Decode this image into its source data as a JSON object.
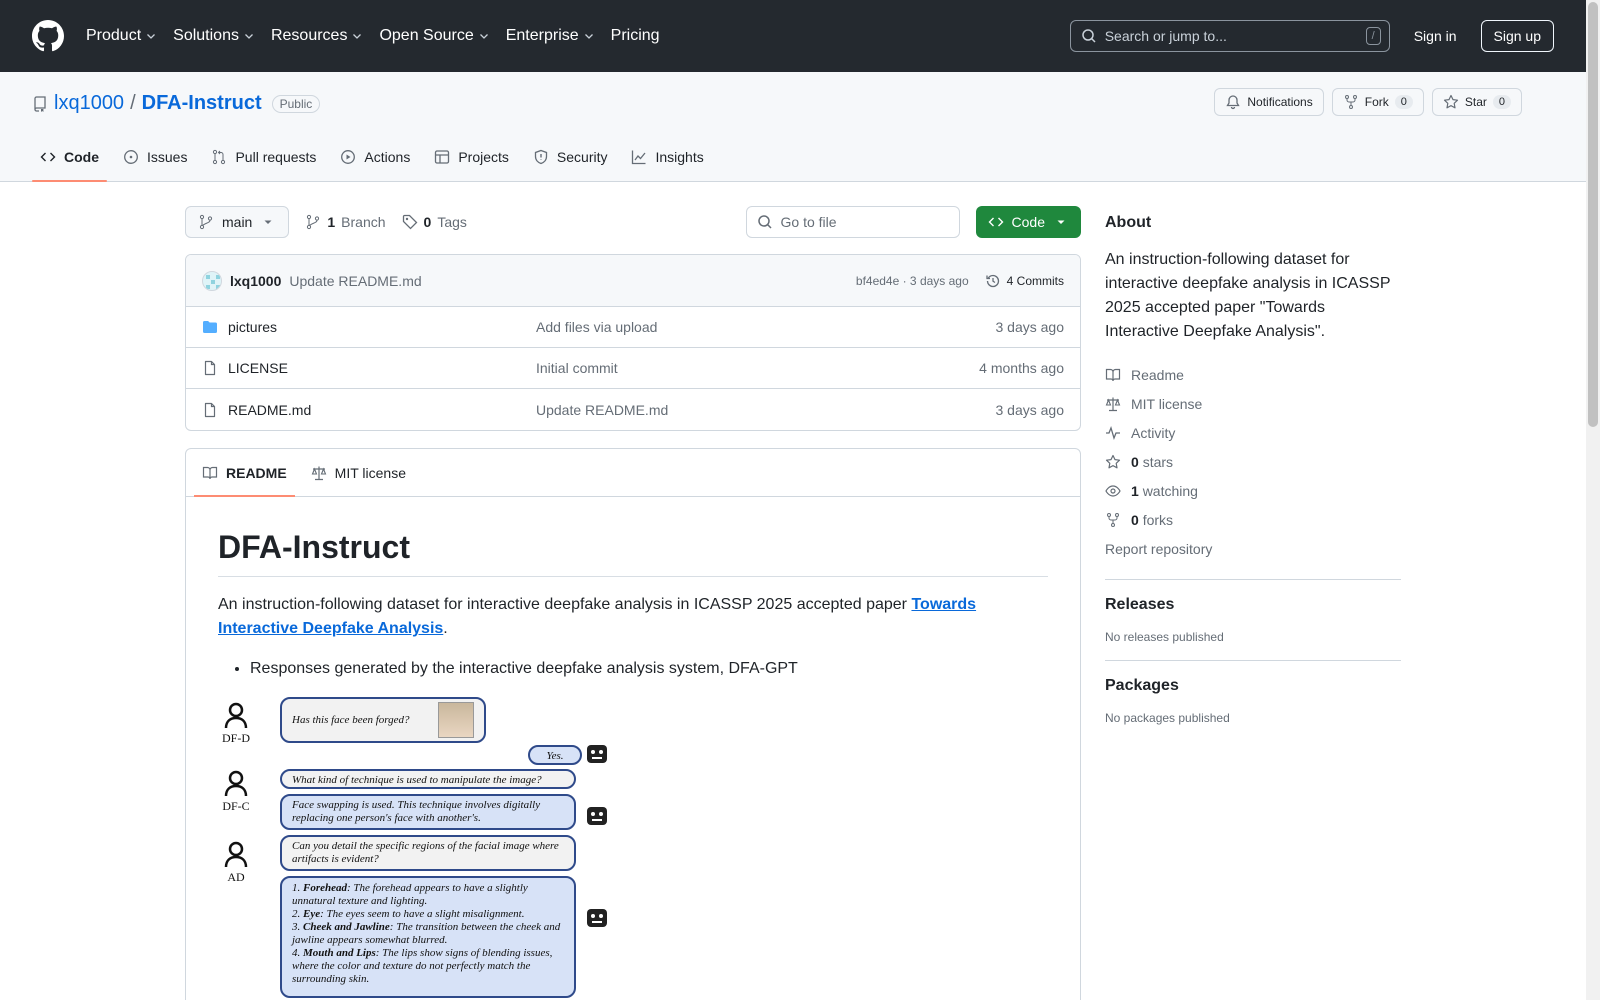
{
  "header": {
    "nav": [
      "Product",
      "Solutions",
      "Resources",
      "Open Source",
      "Enterprise",
      "Pricing"
    ],
    "search_placeholder": "Search or jump to...",
    "slash_key": "/",
    "sign_in": "Sign in",
    "sign_up": "Sign up"
  },
  "repo": {
    "owner": "lxq1000",
    "separator": "/",
    "name": "DFA-Instruct",
    "visibility": "Public",
    "notifications_label": "Notifications",
    "fork_label": "Fork",
    "fork_count": "0",
    "star_label": "Star",
    "star_count": "0",
    "tabs": [
      "Code",
      "Issues",
      "Pull requests",
      "Actions",
      "Projects",
      "Security",
      "Insights"
    ]
  },
  "toolbar": {
    "branch": "main",
    "branch_count": "1",
    "branch_label": "Branch",
    "tag_count": "0",
    "tag_label": "Tags",
    "goto_placeholder": "Go to file",
    "code_button": "Code"
  },
  "commit": {
    "user": "lxq1000",
    "message": "Update README.md",
    "meta": "bf4ed4e · 3 days ago",
    "commits_label": "4 Commits"
  },
  "files": [
    {
      "name": "pictures",
      "type": "folder",
      "message": "Add files via upload",
      "time": "3 days ago"
    },
    {
      "name": "LICENSE",
      "type": "file",
      "message": "Initial commit",
      "time": "4 months ago"
    },
    {
      "name": "README.md",
      "type": "file",
      "message": "Update README.md",
      "time": "3 days ago"
    }
  ],
  "readme": {
    "tabs": [
      "README",
      "MIT license"
    ],
    "title": "DFA-Instruct",
    "intro": "An instruction-following dataset for interactive deepfake analysis in ICASSP 2025 accepted paper ",
    "intro_link": "Towards Interactive Deepfake Analysis",
    "intro_end": ".",
    "bullet": "Responses generated by the interactive deepfake analysis system, DFA-GPT",
    "figure": {
      "roles": [
        "DF-D",
        "DF-C",
        "AD"
      ],
      "q1": "Has this face been forged?",
      "a1": "Yes.",
      "q2": "What kind of technique is used to manipulate the image?",
      "a2": "Face swapping is used. This technique involves digitally replacing one person's face with another's.",
      "q3": "Can you detail the specific regions of the facial image where artifacts is evident?",
      "a3_1_label": "Forehead",
      "a3_1": ": The forehead appears to have a slightly unnatural texture and lighting.",
      "a3_2_label": "Eye",
      "a3_2": ": The eyes seem to have a slight misalignment.",
      "a3_3_label": "Cheek and Jawline",
      "a3_3": ": The transition between the cheek and jawline appears somewhat blurred.",
      "a3_4_label": "Mouth and Lips",
      "a3_4": ": The lips show signs of blending issues, where the color and texture do not perfectly match the surrounding skin."
    }
  },
  "about": {
    "heading": "About",
    "description": "An instruction-following dataset for interactive deepfake analysis in ICASSP 2025 accepted paper \"Towards Interactive Deepfake Analysis\".",
    "readme": "Readme",
    "license": "MIT license",
    "activity": "Activity",
    "stars_count": "0",
    "stars_label": "stars",
    "watching_count": "1",
    "watching_label": "watching",
    "forks_count": "0",
    "forks_label": "forks",
    "report": "Report repository"
  },
  "releases": {
    "heading": "Releases",
    "empty": "No releases published"
  },
  "packages": {
    "heading": "Packages",
    "empty": "No packages published"
  },
  "colors": {
    "header_bg": "#24292f",
    "accent": "#0969da",
    "green": "#1f883d",
    "tab_underline": "#fd8c73"
  }
}
